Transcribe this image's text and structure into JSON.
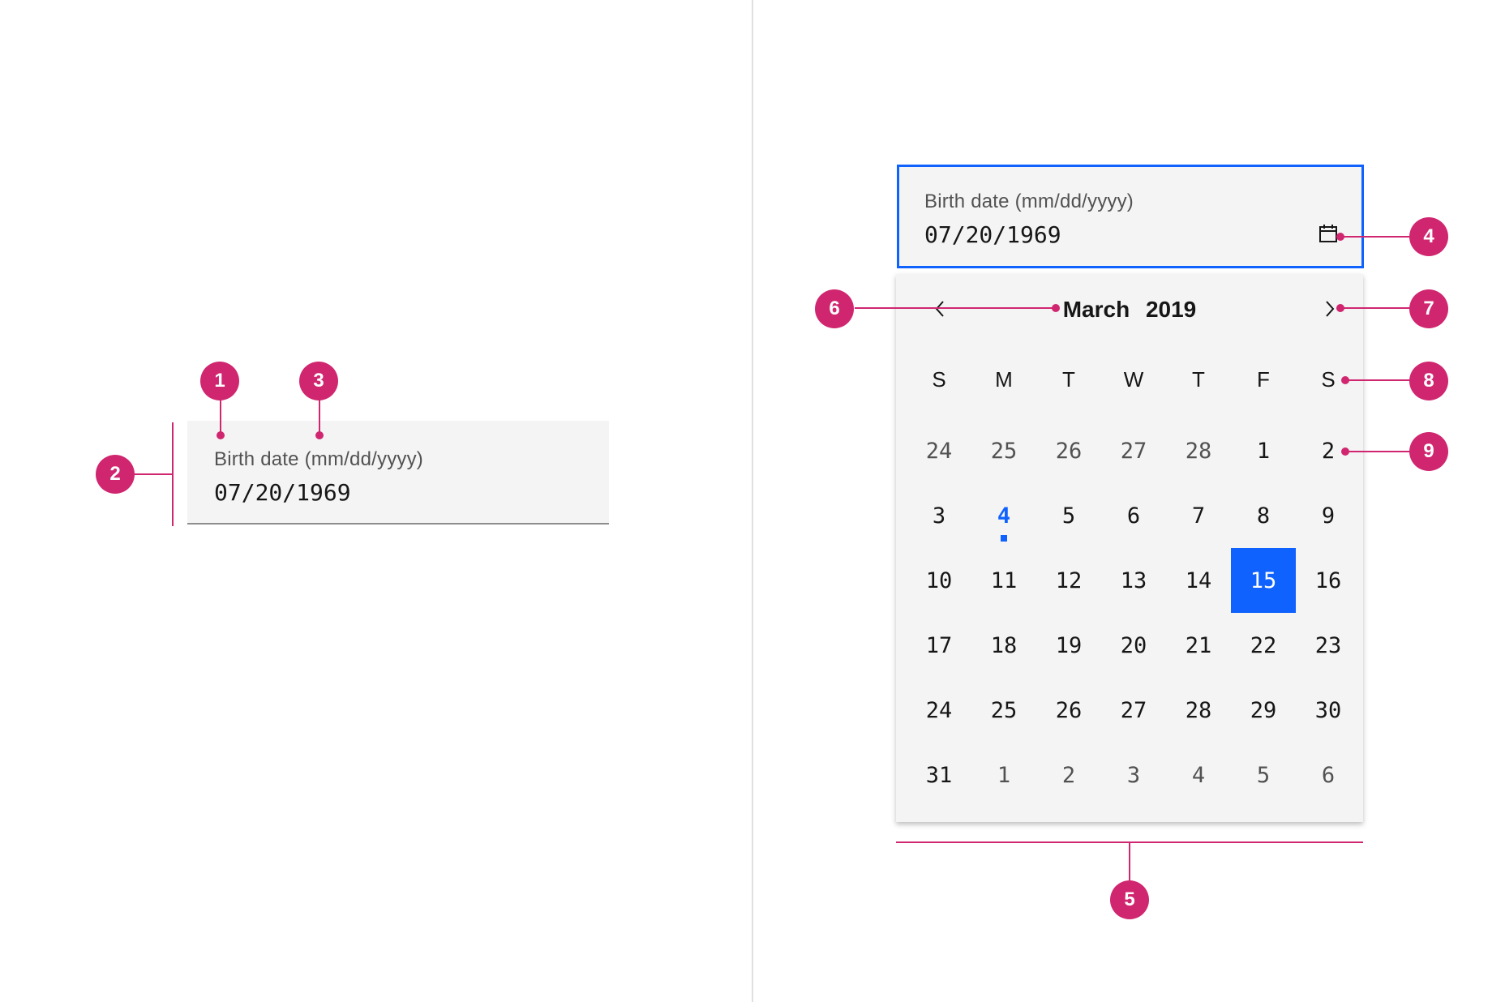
{
  "field": {
    "label": "Birth date (mm/dd/yyyy)",
    "value": "07/20/1969"
  },
  "calendar": {
    "month": "March",
    "year": "2019",
    "weekdays": [
      "S",
      "M",
      "T",
      "W",
      "T",
      "F",
      "S"
    ],
    "weeks": [
      [
        "24",
        "25",
        "26",
        "27",
        "28",
        "1",
        "2"
      ],
      [
        "3",
        "4",
        "5",
        "6",
        "7",
        "8",
        "9"
      ],
      [
        "10",
        "11",
        "12",
        "13",
        "14",
        "15",
        "16"
      ],
      [
        "17",
        "18",
        "19",
        "20",
        "21",
        "22",
        "23"
      ],
      [
        "24",
        "25",
        "26",
        "27",
        "28",
        "29",
        "30"
      ],
      [
        "31",
        "1",
        "2",
        "3",
        "4",
        "5",
        "6"
      ]
    ],
    "today": "4",
    "selected": "15"
  },
  "annotations": [
    "1",
    "2",
    "3",
    "4",
    "5",
    "6",
    "7",
    "8",
    "9"
  ],
  "colors": {
    "accent": "#0f62fe",
    "annotation": "#d02670",
    "field_bg": "#f4f4f4"
  },
  "icons": {
    "calendar": "calendar-icon",
    "prev": "chevron-left-icon",
    "next": "chevron-right-icon"
  }
}
